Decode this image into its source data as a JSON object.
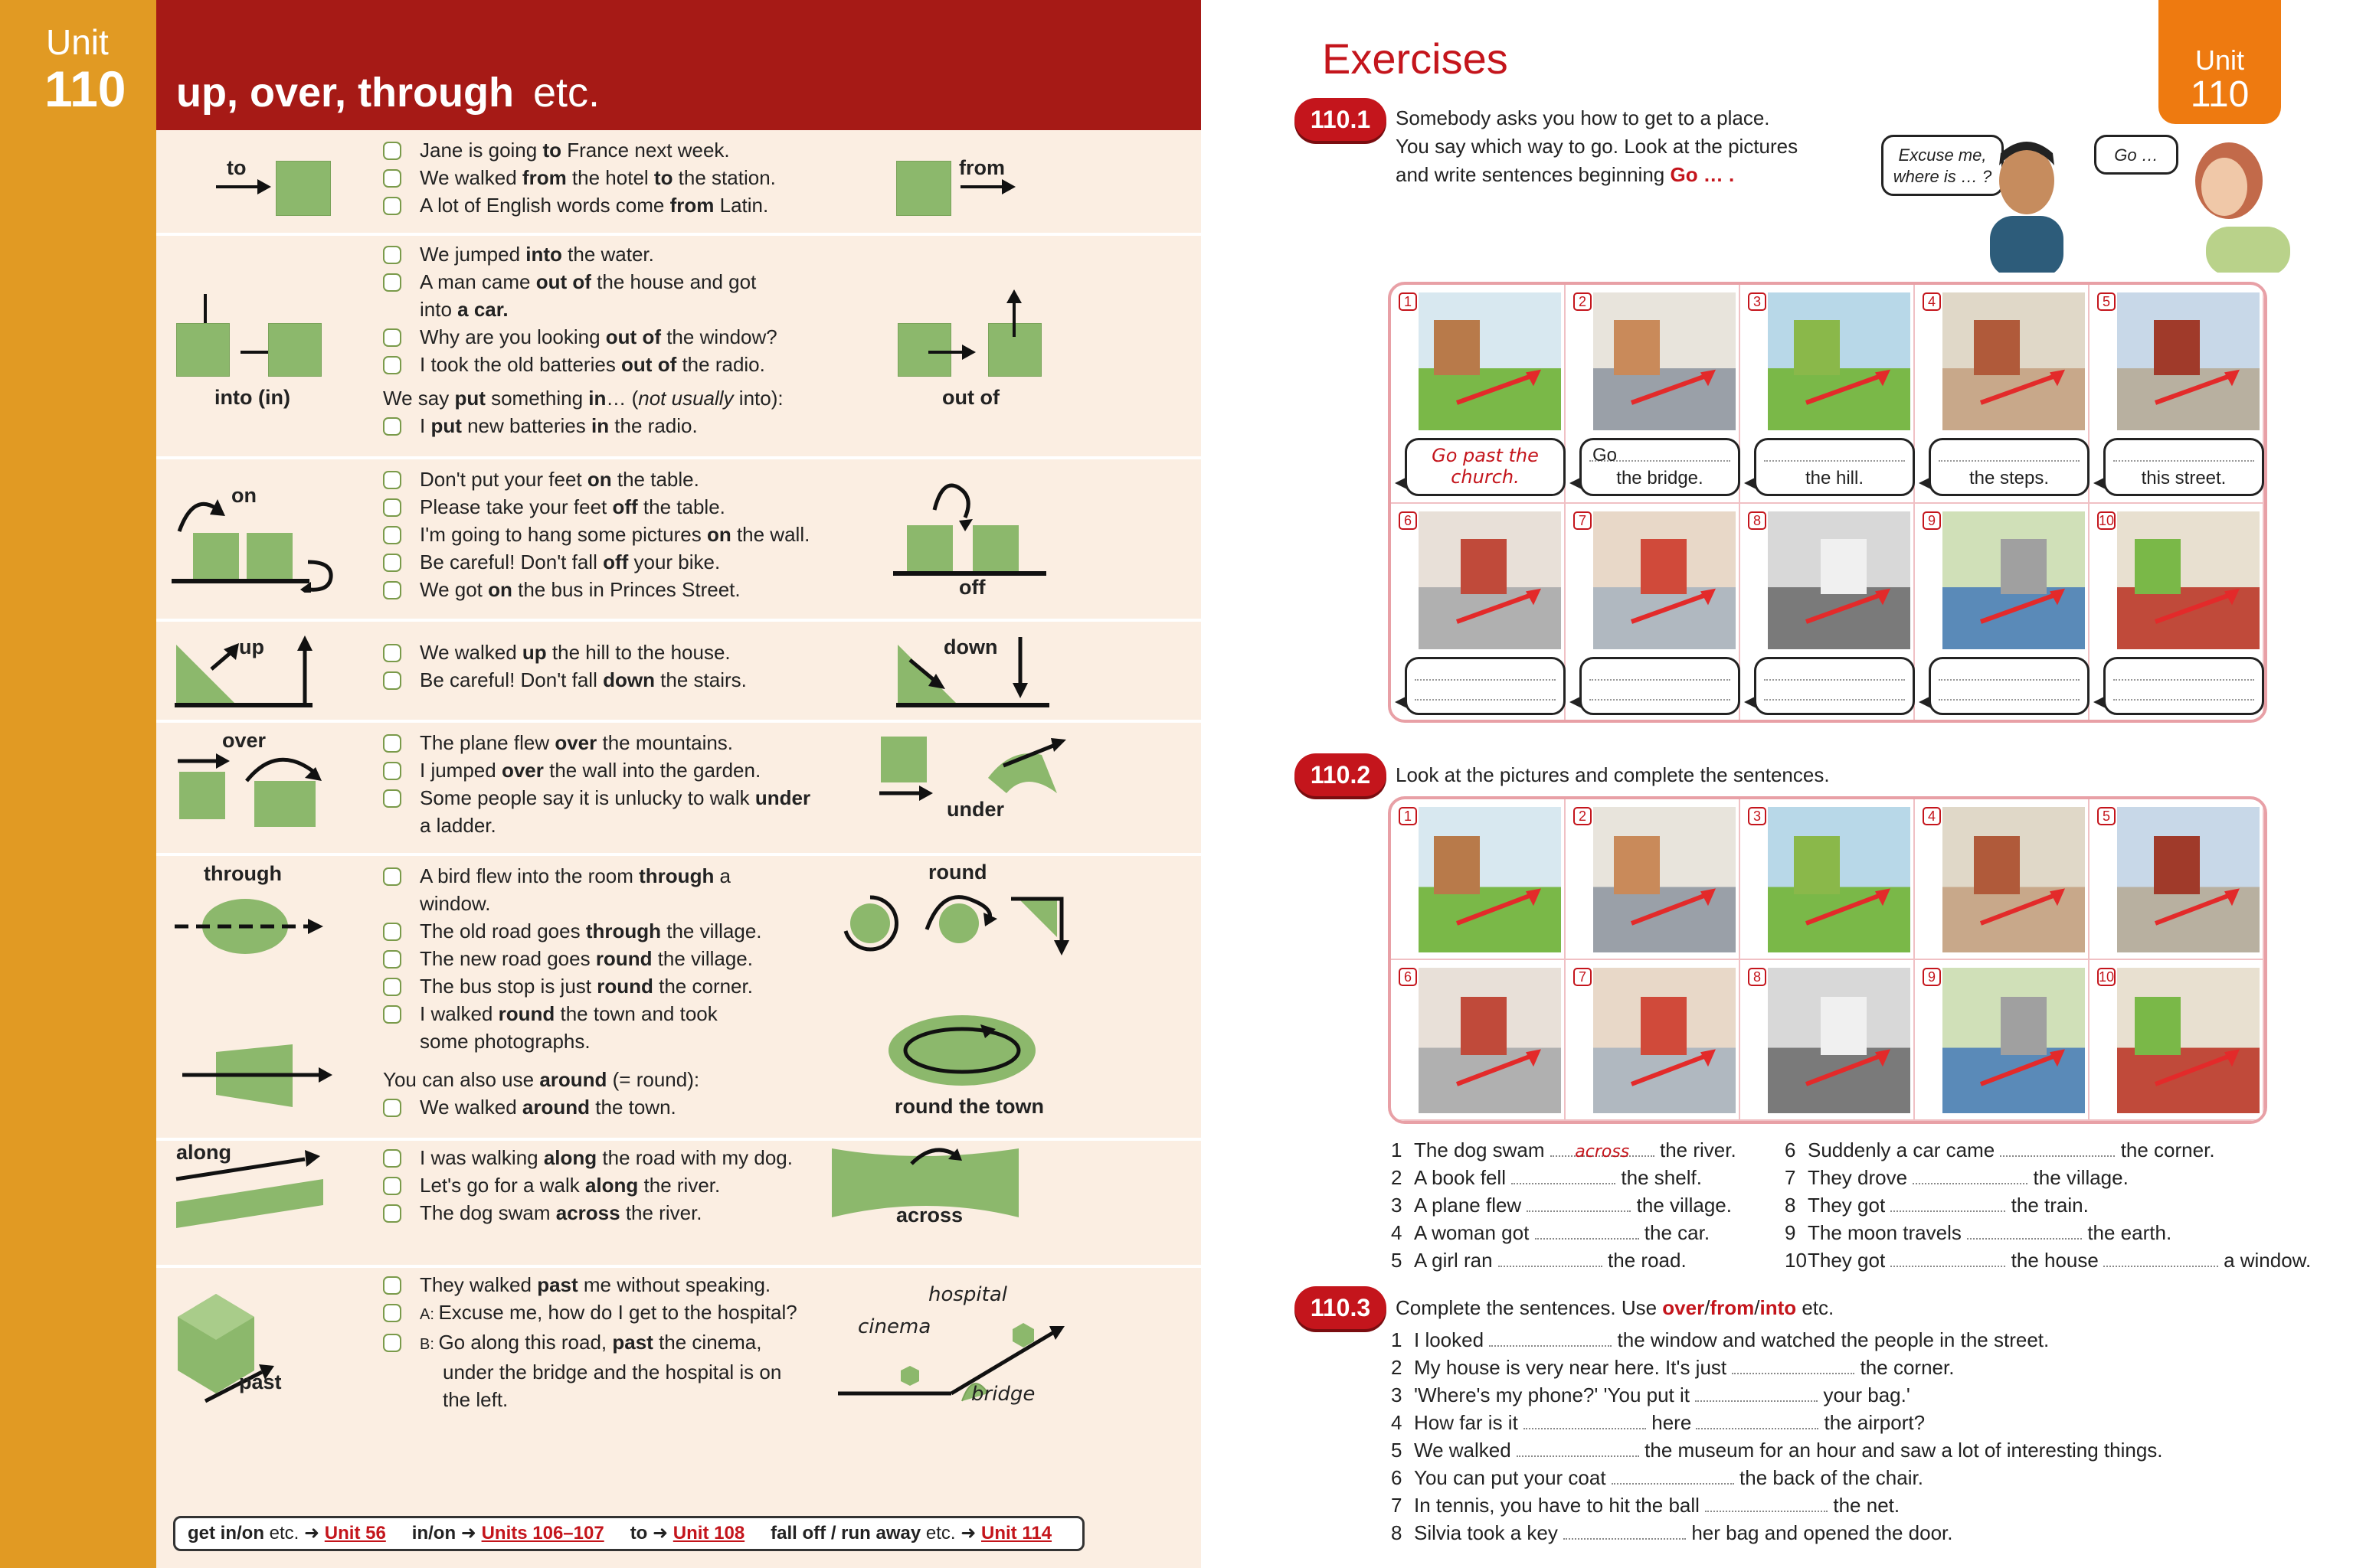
{
  "left": {
    "unit_label": "Unit",
    "unit_number": "110",
    "title_main": "up, over, through",
    "title_suffix": "etc.",
    "rows": {
      "to_from": {
        "label_left": "to",
        "label_right": "from",
        "lines": [
          {
            "parts": [
              "Jane is going ",
              "to",
              " France next week."
            ]
          },
          {
            "parts": [
              "We walked ",
              "from",
              " the hotel ",
              "to",
              " the station."
            ]
          },
          {
            "parts": [
              "A lot of English words come ",
              "from",
              " Latin."
            ]
          }
        ]
      },
      "into_out": {
        "label_left": "into (in)",
        "label_right": "out of",
        "lines": [
          {
            "parts": [
              "We jumped ",
              "into",
              " the water."
            ]
          },
          {
            "parts": [
              "A man came ",
              "out of",
              " the house and got"
            ]
          },
          {
            "cont": true,
            "parts": [
              "into",
              " a car."
            ]
          },
          {
            "parts": [
              "Why are you looking ",
              "out of",
              " the window?"
            ]
          },
          {
            "parts": [
              "I took the old batteries ",
              "out of",
              " the radio."
            ]
          }
        ],
        "note": [
          "We say ",
          "put",
          " something ",
          "in",
          "… (",
          "not usually",
          " into):"
        ],
        "note_line": [
          "I ",
          "put",
          " new batteries ",
          "in",
          " the radio."
        ]
      },
      "on_off": {
        "label_left": "on",
        "label_right": "off",
        "lines": [
          {
            "parts": [
              "Don't put your feet ",
              "on",
              " the table."
            ]
          },
          {
            "parts": [
              "Please take your feet ",
              "off",
              " the table."
            ]
          },
          {
            "parts": [
              "I'm going to hang some pictures ",
              "on",
              " the wall."
            ]
          },
          {
            "parts": [
              "Be careful!  Don't fall ",
              "off",
              " your bike."
            ]
          },
          {
            "parts": [
              "We got ",
              "on",
              " the bus in Princes Street."
            ]
          }
        ]
      },
      "up_down": {
        "label_left": "up",
        "label_right": "down",
        "lines": [
          {
            "parts": [
              "We walked ",
              "up",
              " the hill to the house."
            ]
          },
          {
            "parts": [
              "Be careful!  Don't fall ",
              "down",
              " the stairs."
            ]
          }
        ]
      },
      "over_under": {
        "label_left": "over",
        "label_right": "under",
        "lines": [
          {
            "parts": [
              "The plane flew ",
              "over",
              " the mountains."
            ]
          },
          {
            "parts": [
              "I jumped ",
              "over",
              " the wall into the garden."
            ]
          },
          {
            "parts": [
              "Some people say it is unlucky to walk ",
              "under"
            ]
          },
          {
            "cont": true,
            "parts": [
              "a ladder."
            ]
          }
        ]
      },
      "through_round": {
        "label_left": "through",
        "label_right": "round",
        "label_right2": "round the town",
        "lines": [
          {
            "parts": [
              "A bird flew into the room ",
              "through",
              " a"
            ]
          },
          {
            "cont": true,
            "parts": [
              "window."
            ]
          },
          {
            "parts": [
              "The old road goes ",
              "through",
              " the village."
            ]
          },
          {
            "parts": [
              "The new road goes ",
              "round",
              " the village."
            ]
          },
          {
            "parts": [
              "The bus stop is just ",
              "round",
              " the corner."
            ]
          },
          {
            "parts": [
              "I walked ",
              "round",
              " the town and took"
            ]
          },
          {
            "cont": true,
            "parts": [
              "some photographs."
            ]
          }
        ],
        "note": [
          "You can also use ",
          "around",
          " (= round):"
        ],
        "note_line": [
          "We walked ",
          "around",
          " the town."
        ]
      },
      "along_across": {
        "label_left": "along",
        "label_right": "across",
        "lines": [
          {
            "parts": [
              "I was walking ",
              "along",
              " the road with my dog."
            ]
          },
          {
            "parts": [
              "Let's go for a walk ",
              "along",
              " the river."
            ]
          },
          {
            "parts": [
              "The dog swam ",
              "across",
              " the river."
            ]
          }
        ]
      },
      "past": {
        "label_left": "past",
        "label_hospital": "hospital",
        "label_cinema": "cinema",
        "label_bridge": "bridge",
        "lines": [
          {
            "parts": [
              "They walked ",
              "past",
              " me without speaking."
            ]
          },
          {
            "prefix": "A:",
            "parts": [
              "Excuse me, how do I get to the hospital?"
            ]
          },
          {
            "prefix": "B:",
            "parts": [
              "Go along this road, ",
              "past",
              " the cinema,"
            ]
          },
          {
            "cont": true,
            "parts": [
              "under the bridge and the hospital is on"
            ]
          },
          {
            "cont": true,
            "parts": [
              "the left."
            ]
          }
        ]
      }
    },
    "footer": [
      {
        "text": "get in/on",
        "rest": " etc. ➜ ",
        "link": "Unit 56"
      },
      {
        "text": "in/on",
        "rest": " ➜ ",
        "link": "Units 106–107"
      },
      {
        "text": "to",
        "rest": " ➜ ",
        "link": "Unit 108"
      },
      {
        "text": "fall off / run away",
        "rest": " etc. ➜ ",
        "link": "Unit 114"
      }
    ]
  },
  "right": {
    "title": "Exercises",
    "unit_label": "Unit",
    "unit_number": "110",
    "ex1": {
      "number": "110.1",
      "instructions": [
        "Somebody asks you how to get to a place.",
        "You say which way to go.  Look at the pictures",
        "and write sentences beginning "
      ],
      "go": "Go … .",
      "speech_man": "Excuse me, where is … ?",
      "speech_woman": "Go …",
      "cells": [
        {
          "n": "1",
          "answer": "Go past the church.",
          "text": ""
        },
        {
          "n": "2",
          "go": "Go",
          "text": "the bridge."
        },
        {
          "n": "3",
          "text": "the hill."
        },
        {
          "n": "4",
          "text": "the steps."
        },
        {
          "n": "5",
          "text": "this street."
        },
        {
          "n": "6",
          "text": ""
        },
        {
          "n": "7",
          "text": ""
        },
        {
          "n": "8",
          "text": ""
        },
        {
          "n": "9",
          "text": ""
        },
        {
          "n": "10",
          "text": ""
        }
      ]
    },
    "ex2": {
      "number": "110.2",
      "instructions": "Look at the pictures and complete the sentences.",
      "cells": [
        "1",
        "2",
        "3",
        "4",
        "5",
        "6",
        "7",
        "8",
        "9",
        "10"
      ],
      "sentences_left": [
        {
          "n": "1",
          "a": "The dog swam",
          "ans": "across",
          "b": "the river."
        },
        {
          "n": "2",
          "a": "A book fell",
          "b": "the shelf."
        },
        {
          "n": "3",
          "a": "A plane flew",
          "b": "the village."
        },
        {
          "n": "4",
          "a": "A woman got",
          "b": "the car."
        },
        {
          "n": "5",
          "a": "A girl ran",
          "b": "the road."
        }
      ],
      "sentences_right": [
        {
          "n": "6",
          "a": "Suddenly a car came",
          "b": "the corner."
        },
        {
          "n": "7",
          "a": "They drove",
          "b": "the village."
        },
        {
          "n": "8",
          "a": "They got",
          "b": "the train."
        },
        {
          "n": "9",
          "a": "The moon travels",
          "b": "the earth."
        },
        {
          "n": "10",
          "a": "They got",
          "b": "the house",
          "c": "a window."
        }
      ]
    },
    "ex3": {
      "number": "110.3",
      "instructions_a": "Complete the sentences.  Use ",
      "words": [
        "over",
        "/",
        "from",
        "/",
        "into"
      ],
      "instructions_b": " etc.",
      "sentences": [
        {
          "n": "1",
          "a": "I looked",
          "b": "the window and watched the people in the street."
        },
        {
          "n": "2",
          "a": "My house is very near here.  It's just",
          "b": "the corner."
        },
        {
          "n": "3",
          "a": "'Where's my phone?'   'You put it",
          "b": "your bag.'"
        },
        {
          "n": "4",
          "a": "How far is it",
          "b": "here",
          "c": "the airport?"
        },
        {
          "n": "5",
          "a": "We walked",
          "b": "the museum for an hour and saw a lot of interesting things."
        },
        {
          "n": "6",
          "a": "You can put your coat",
          "b": "the back of the chair."
        },
        {
          "n": "7",
          "a": "In tennis, you have to hit the ball",
          "b": "the net."
        },
        {
          "n": "8",
          "a": "Silvia took a key",
          "b": "her bag and opened the door."
        }
      ]
    }
  },
  "colors": {
    "red": "#c4151c",
    "dark_red": "#a61a16",
    "orange": "#e19a23",
    "cream": "#fbeee2",
    "green": "#8cb86c",
    "pink_border": "#e8a0a6"
  }
}
